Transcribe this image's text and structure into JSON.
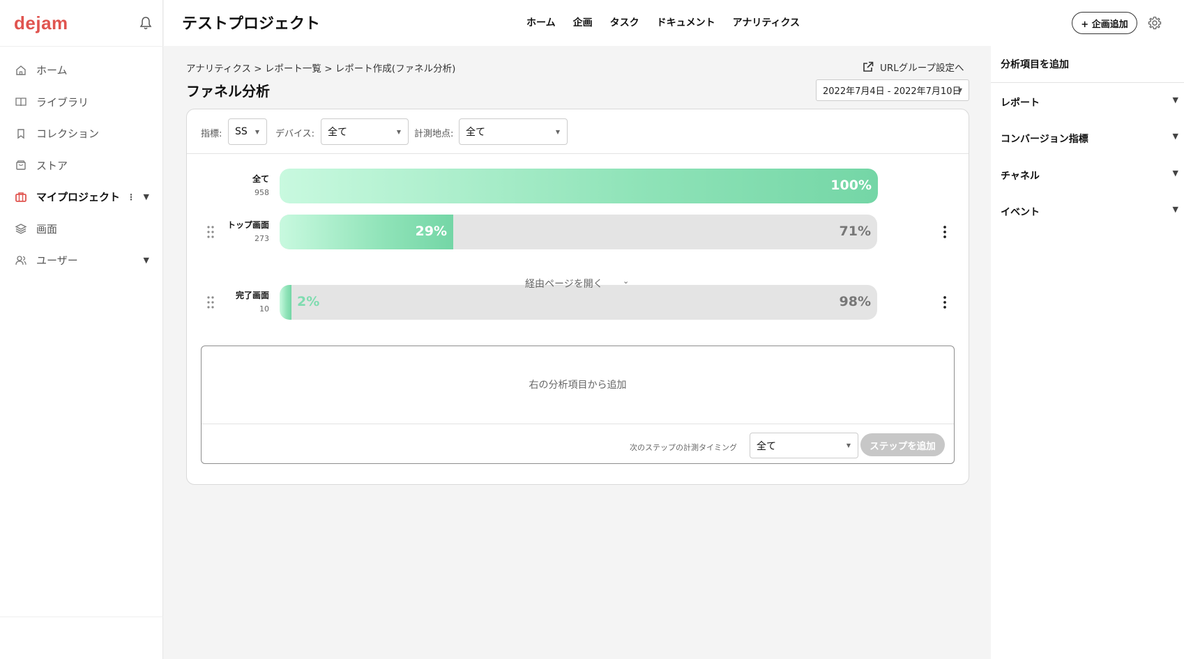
{
  "sidebar": {
    "logo": "dejam",
    "items": [
      {
        "label": "ホーム"
      },
      {
        "label": "ライブラリ"
      },
      {
        "label": "コレクション"
      },
      {
        "label": "ストア"
      },
      {
        "label": "マイプロジェクト"
      },
      {
        "label": "画面"
      },
      {
        "label": "ユーザー"
      }
    ]
  },
  "header": {
    "project_title": "テストプロジェクト",
    "nav": [
      "ホーム",
      "企画",
      "タスク",
      "ドキュメント",
      "アナリティクス"
    ],
    "add_plan_label": "+ 企画追加"
  },
  "right_panel": {
    "title": "分析項目を追加",
    "sections": [
      "レポート",
      "コンバージョン指標",
      "チャネル",
      "イベント"
    ]
  },
  "main": {
    "breadcrumb": "アナリティクス  > レポート一覧  > レポート作成(ファネル分析)",
    "page_title": "ファネル分析",
    "url_group_link": "URLグループ設定へ",
    "date_range": "2022年7月4日 - 2022年7月10日",
    "filters": {
      "metric_label": "指標:",
      "metric_value": "SS",
      "device_label": "デバイス:",
      "device_value": "全て",
      "point_label": "計測地点:",
      "point_value": "全て"
    },
    "via_pages_label": "経由ページを開く",
    "add_hint": "右の分析項目から追加",
    "timing_label": "次のステップの計測タイミング",
    "timing_value": "全て",
    "add_step_label": "ステップを追加"
  },
  "chart_data": {
    "type": "bar",
    "categories": [
      "全て",
      "トップ画面",
      "完了画面"
    ],
    "values": [
      958,
      273,
      10
    ],
    "steps": [
      {
        "name": "全て",
        "count": "958",
        "rate": 100,
        "rate_label": "100%",
        "drop_label": ""
      },
      {
        "name": "トップ画面",
        "count": "273",
        "rate": 29,
        "rate_label": "29%",
        "drop_label": "71%"
      },
      {
        "name": "完了画面",
        "count": "10",
        "rate": 2,
        "rate_label": "2%",
        "drop_label": "98%"
      }
    ]
  },
  "colors": {
    "brand": "#e0544f",
    "fill_start": "#c8f9df",
    "fill_end": "#74d6a6",
    "track": "#e4e4e4"
  }
}
